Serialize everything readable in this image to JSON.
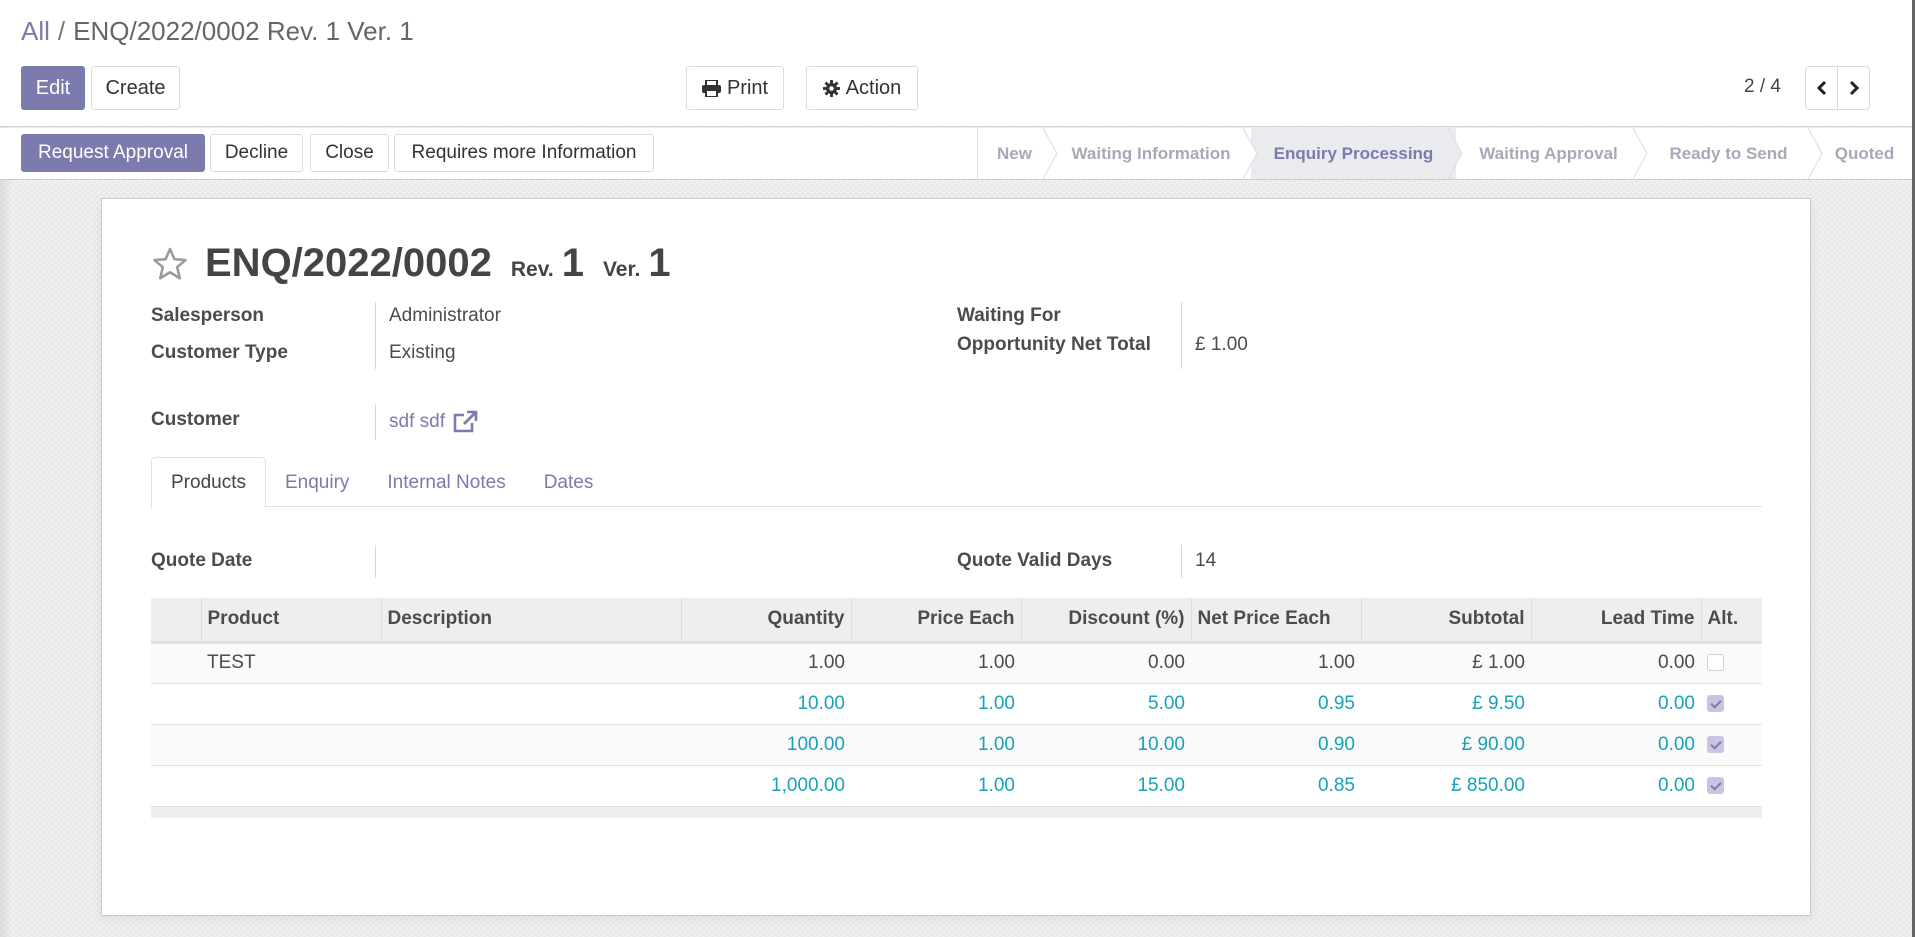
{
  "breadcrumb": {
    "parent": "All",
    "separator": "/",
    "current": "ENQ/2022/0002 Rev. 1 Ver. 1"
  },
  "toolbar": {
    "edit_label": "Edit",
    "create_label": "Create",
    "print_label": "Print",
    "action_label": "Action",
    "pager_value": "2 / 4"
  },
  "statusbar": {
    "buttons": [
      {
        "label": "Request Approval"
      },
      {
        "label": "Decline"
      },
      {
        "label": "Close"
      },
      {
        "label": "Requires more Information"
      }
    ],
    "stages": [
      {
        "label": "New",
        "active": false
      },
      {
        "label": "Waiting Information",
        "active": false
      },
      {
        "label": "Enquiry Processing",
        "active": true
      },
      {
        "label": "Waiting Approval",
        "active": false
      },
      {
        "label": "Ready to Send",
        "active": false
      },
      {
        "label": "Quoted",
        "active": false
      }
    ]
  },
  "record": {
    "name": "ENQ/2022/0002",
    "rev_label": "Rev.",
    "rev_value": "1",
    "ver_label": "Ver.",
    "ver_value": "1",
    "starred": false,
    "fields": {
      "salesperson": {
        "label": "Salesperson",
        "value": "Administrator"
      },
      "customer_type": {
        "label": "Customer Type",
        "value": "Existing"
      },
      "customer": {
        "label": "Customer",
        "value": "sdf sdf"
      },
      "waiting_for": {
        "label": "Waiting For",
        "value": ""
      },
      "opportunity_net_total": {
        "label": "Opportunity Net Total",
        "value": "£ 1.00"
      }
    }
  },
  "tabs": [
    {
      "label": "Products",
      "active": true
    },
    {
      "label": "Enquiry",
      "active": false
    },
    {
      "label": "Internal Notes",
      "active": false
    },
    {
      "label": "Dates",
      "active": false
    }
  ],
  "products_tab": {
    "quote_date": {
      "label": "Quote Date",
      "value": ""
    },
    "quote_valid_days": {
      "label": "Quote Valid Days",
      "value": "14"
    },
    "table": {
      "columns": [
        "",
        "Product",
        "Description",
        "Quantity",
        "Price Each",
        "Discount (%)",
        "Net Price Each",
        "Subtotal",
        "Lead Time",
        "Alt."
      ],
      "rows": [
        {
          "product": "TEST",
          "description": "",
          "quantity": "1.00",
          "price_each": "1.00",
          "discount": "0.00",
          "net_price_each": "1.00",
          "subtotal": "£ 1.00",
          "lead_time": "0.00",
          "alt": false
        },
        {
          "product": "",
          "description": "",
          "quantity": "10.00",
          "price_each": "1.00",
          "discount": "5.00",
          "net_price_each": "0.95",
          "subtotal": "£ 9.50",
          "lead_time": "0.00",
          "alt": true
        },
        {
          "product": "",
          "description": "",
          "quantity": "100.00",
          "price_each": "1.00",
          "discount": "10.00",
          "net_price_each": "0.90",
          "subtotal": "£ 90.00",
          "lead_time": "0.00",
          "alt": true
        },
        {
          "product": "",
          "description": "",
          "quantity": "1,000.00",
          "price_each": "1.00",
          "discount": "15.00",
          "net_price_each": "0.85",
          "subtotal": "£ 850.00",
          "lead_time": "0.00",
          "alt": true
        }
      ]
    }
  },
  "colors": {
    "primary": "#7c7bad",
    "alt_line_text": "#17a2b8",
    "stage_inactive": "#a8a8b8",
    "stage_active_bg": "#e9ebef"
  }
}
